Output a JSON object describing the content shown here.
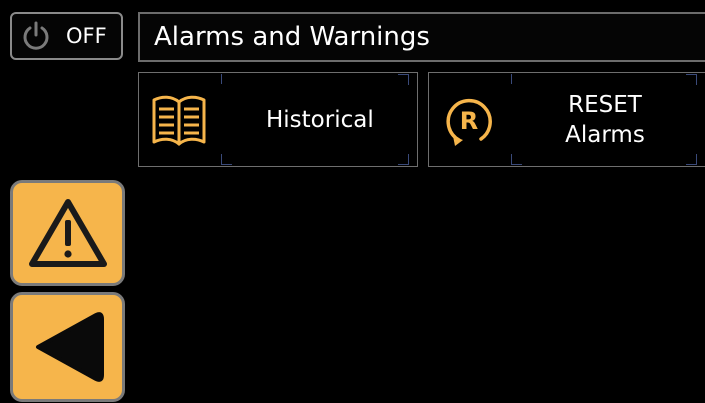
{
  "power": {
    "state_label": "OFF",
    "icon": "power-icon"
  },
  "header": {
    "title": "Alarms and Warnings"
  },
  "tiles": {
    "historical": {
      "label": "Historical",
      "icon": "book-icon"
    },
    "reset": {
      "label_line1": "RESET",
      "label_line2": "Alarms",
      "icon": "reset-r-icon"
    }
  },
  "nav": {
    "warning_icon": "warning-triangle-icon",
    "back_icon": "back-arrow-icon"
  },
  "colors": {
    "accent": "#f6b54b",
    "background": "#000000",
    "border": "#7a7a7a"
  }
}
